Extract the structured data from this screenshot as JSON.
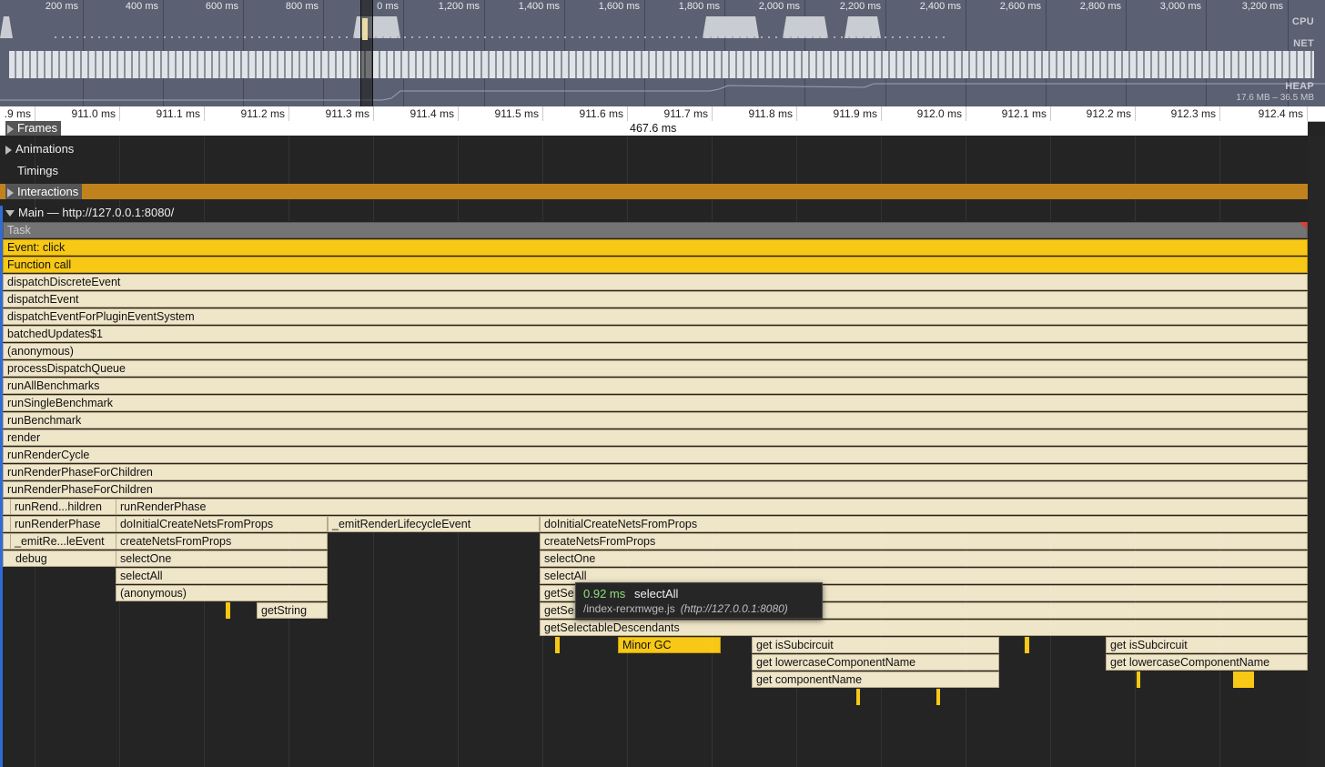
{
  "overview": {
    "time_labels": [
      "200 ms",
      "400 ms",
      "600 ms",
      "800 ms",
      "0 ms",
      "1,200 ms",
      "1,400 ms",
      "1,600 ms",
      "1,800 ms",
      "2,000 ms",
      "2,200 ms",
      "2,400 ms",
      "2,600 ms",
      "2,800 ms",
      "3,000 ms",
      "3,200 ms"
    ],
    "lanes": {
      "cpu": "CPU",
      "net": "NET",
      "heap": "HEAP"
    },
    "heap_range": "17.6 MB – 36.5 MB"
  },
  "ruler": {
    "labels": [
      ".9 ms",
      "911.0 ms",
      "911.1 ms",
      "911.2 ms",
      "911.3 ms",
      "911.4 ms",
      "911.5 ms",
      "911.6 ms",
      "911.7 ms",
      "911.8 ms",
      "911.9 ms",
      "912.0 ms",
      "912.1 ms",
      "912.2 ms",
      "912.3 ms",
      "912.4 ms"
    ]
  },
  "tracks": {
    "frames": "Frames",
    "frames_duration": "467.6 ms",
    "animations": "Animations",
    "timings": "Timings",
    "interactions": "Interactions",
    "main": "Main — http://127.0.0.1:8080/"
  },
  "flame": {
    "task": "Task",
    "event_click": "Event: click",
    "function_call": "Function call",
    "stack": [
      "dispatchDiscreteEvent",
      "dispatchEvent",
      "dispatchEventForPluginEventSystem",
      "batchedUpdates$1",
      "(anonymous)",
      "processDispatchQueue",
      "runAllBenchmarks",
      "runSingleBenchmark",
      "runBenchmark",
      "render",
      "runRenderCycle",
      "runRenderPhaseForChildren",
      "runRenderPhaseForChildren"
    ],
    "left_column": [
      "runRend...hildren",
      "runRenderPhase",
      "_emitRe...leEvent",
      "debug"
    ],
    "mid_column": [
      "runRenderPhase",
      "doInitialCreateNetsFromProps",
      "createNetsFromProps",
      "selectOne",
      "selectAll",
      "(anonymous)"
    ],
    "get_string": "getString",
    "emit_lifecycle": "_emitRenderLifecycleEvent",
    "right_column": [
      "doInitialCreateNetsFromProps",
      "createNetsFromProps",
      "selectOne",
      "selectAll",
      "getSe",
      "getSe",
      "getSelectableDescendants"
    ],
    "minor_gc": "Minor GC",
    "sub_a": [
      "get isSubcircuit",
      "get lowercaseComponentName",
      "get componentName"
    ],
    "sub_b": [
      "get isSubcircuit",
      "get lowercaseComponentName"
    ]
  },
  "tooltip": {
    "duration": "0.92 ms",
    "name": "selectAll",
    "file": "/index-rerxmwge.js",
    "url": "(http://127.0.0.1:8080)"
  },
  "colors": {
    "event": "#f7c815",
    "js": "#efe5c9",
    "interactions": "#c0821c",
    "task": "#747474"
  }
}
